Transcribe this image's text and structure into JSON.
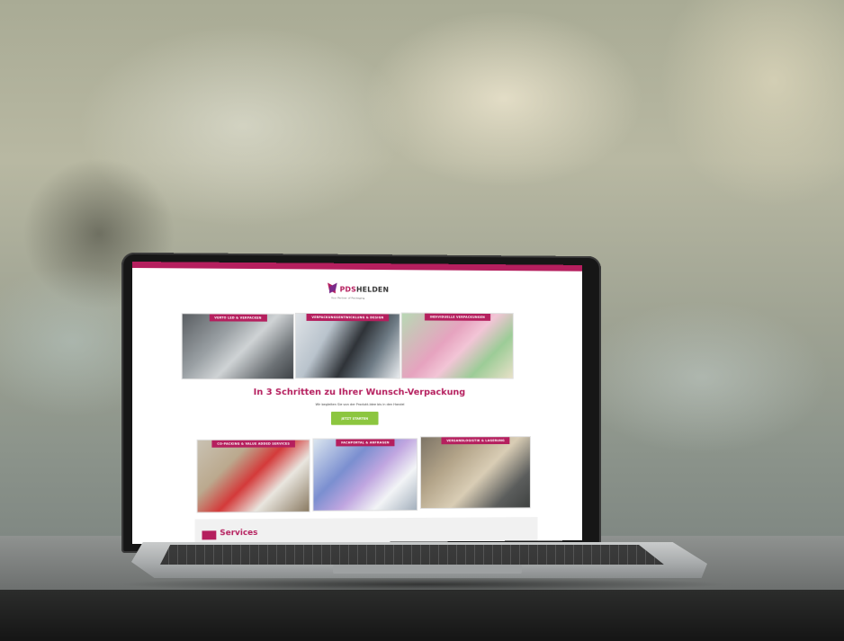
{
  "website": {
    "logo": {
      "brand_prefix": "PDS",
      "brand_suffix": "HELDEN",
      "tagline": "Your Partner of Packaging"
    },
    "tiles_row1": [
      {
        "label": "VERTO LED & VERPACKEN"
      },
      {
        "label": "VERPACKUNGSENTWICKLUNG & DESIGN"
      },
      {
        "label": "INDIVIDUELLE VERPACKUNGEN"
      }
    ],
    "headline": "In 3 Schritten zu Ihrer Wunsch-Verpackung",
    "subline": "Wir begleiten Sie von der Produkt-Idee bis in den Handel",
    "cta_label": "JETZT STARTEN",
    "tiles_row2": [
      {
        "label": "CO-PACKING & VALUE ADDED SERVICES"
      },
      {
        "label": "FACHPORTAL & ANFRAGEN"
      },
      {
        "label": "VERSANDLOGISTIK & LAGERUNG"
      }
    ],
    "services_title": "Services"
  },
  "colors": {
    "brand": "#b51f5e",
    "cta": "#8cc63f"
  }
}
